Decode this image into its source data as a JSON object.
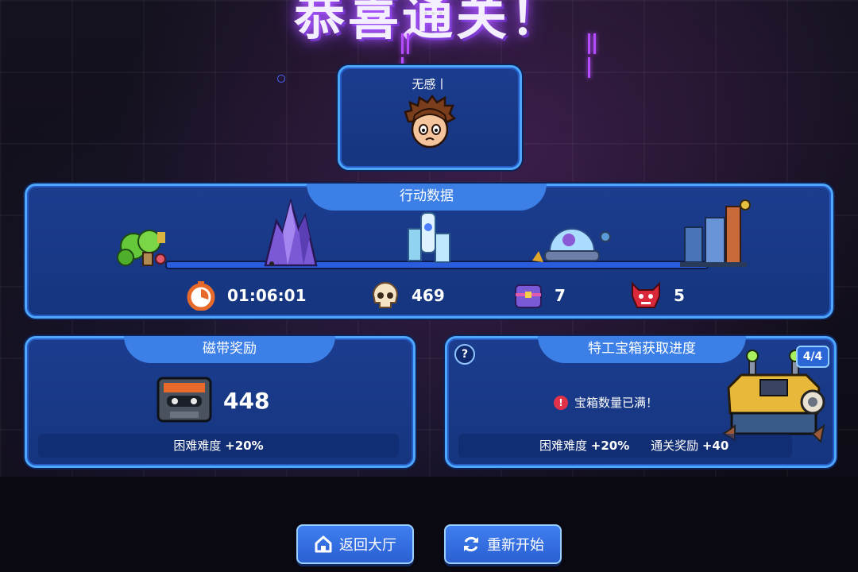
{
  "banner": {
    "title": "恭喜通关！"
  },
  "player": {
    "name": "无感丨"
  },
  "action_data": {
    "title": "行动数据",
    "stats": [
      {
        "icon": "stopwatch-icon",
        "value": "01:06:01"
      },
      {
        "icon": "skull-icon",
        "value": "469"
      },
      {
        "icon": "treasure-chest-icon",
        "value": "7"
      },
      {
        "icon": "demon-mask-icon",
        "value": "5"
      }
    ]
  },
  "tape_reward": {
    "title": "磁带奖励",
    "value": "448",
    "difficulty_label": "困难难度",
    "difficulty_bonus": "+20%"
  },
  "agent_chest": {
    "title": "特工宝箱获取进度",
    "message": "宝箱数量已满！",
    "progress": "4/4",
    "difficulty_label": "困难难度",
    "difficulty_bonus": "+20%",
    "clear_label": "通关奖励",
    "clear_bonus": "+40"
  },
  "buttons": {
    "back": "返回大厅",
    "restart": "重新开始"
  },
  "colors": {
    "panel_bg": "#1c3d8f",
    "panel_border": "#4ea7ff",
    "tab": "#3c7fe6",
    "glow": "#b45cff"
  }
}
